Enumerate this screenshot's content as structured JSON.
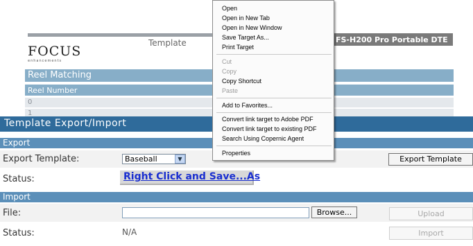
{
  "background": {
    "tab_template": "Template",
    "header_text": "FS-H200 Pro Portable DTE",
    "logo": "FOCUS",
    "logo_sub": "enhancements",
    "reel_title": "Reel Matching",
    "reel_number_label": "Reel Number",
    "rows": [
      "0",
      "1"
    ]
  },
  "panel": {
    "title": "Template Export/Import",
    "export_section": "Export",
    "export_template_label": "Export Template:",
    "export_select_value": "Baseball",
    "export_button": "Export Template",
    "status_label": "Status:",
    "link_text": "Right Click and Save...As",
    "import_section": "Import",
    "file_label": "File:",
    "file_value": "",
    "browse_button": "Browse...",
    "upload_button": "Upload",
    "import_status_label": "Status:",
    "import_status_value": "N/A",
    "import_button": "Import"
  },
  "context_menu": {
    "open": "Open",
    "open_new_tab": "Open in New Tab",
    "open_new_window": "Open in New Window",
    "save_target_as": "Save Target As...",
    "print_target": "Print Target",
    "cut": "Cut",
    "copy": "Copy",
    "copy_shortcut": "Copy Shortcut",
    "paste": "Paste",
    "add_favorites": "Add to Favorites...",
    "convert_adobe": "Convert link target to Adobe PDF",
    "convert_existing": "Convert link target to existing PDF",
    "search_copernic": "Search Using Copernic Agent",
    "properties": "Properties"
  },
  "colors": {
    "title_bar": "#2f6b9b",
    "section_bar": "#5b8fb9",
    "link": "#1a2fd0"
  }
}
